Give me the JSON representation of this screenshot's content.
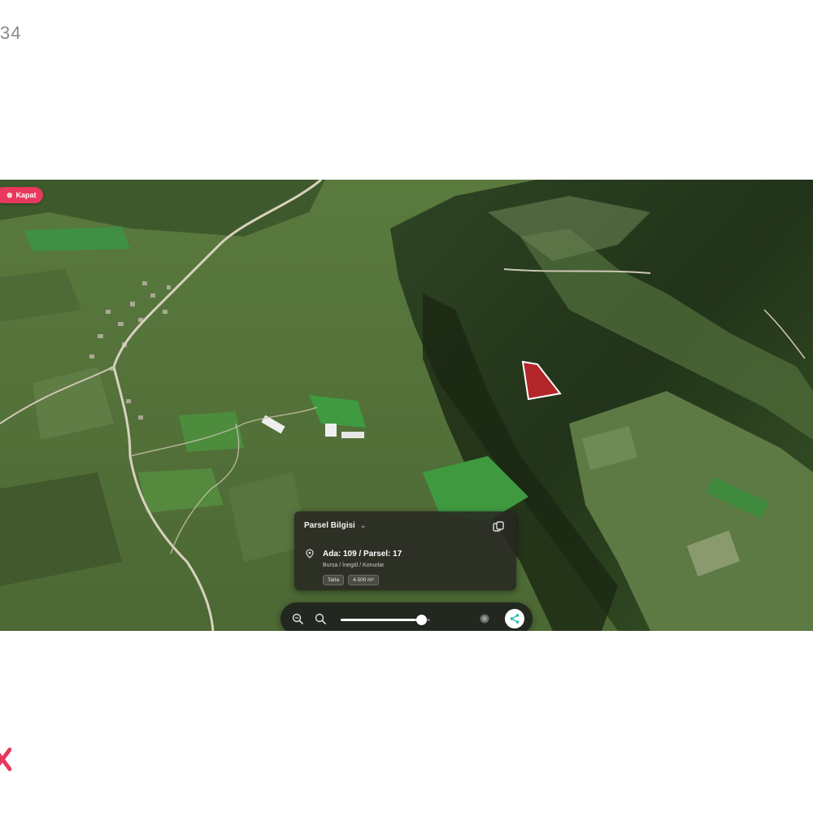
{
  "page": {
    "corner_text": "34"
  },
  "map": {
    "close_chip": {
      "label": "Kapat",
      "icon": "close-icon",
      "color": "#e8385d"
    },
    "parcel_marker_color": "#b3262a",
    "info_panel": {
      "title": "Parsel Bilgisi",
      "parcel_title": "Ada: 109 / Parsel: 17",
      "location": "Bursa / İnegöl / Konurlar",
      "tags": [
        "Tarla",
        "4.500 m²"
      ],
      "copy_icon": "copy-icon",
      "pin_icon": "location-pin-icon"
    },
    "toolbar": {
      "zoom_out_icon": "zoom-out-icon",
      "zoom_in_icon": "zoom-in-icon",
      "slider_value": 0.9,
      "layer_icon": "layers-icon",
      "share_icon": "share-icon",
      "accent_color": "#21b8b0"
    }
  }
}
